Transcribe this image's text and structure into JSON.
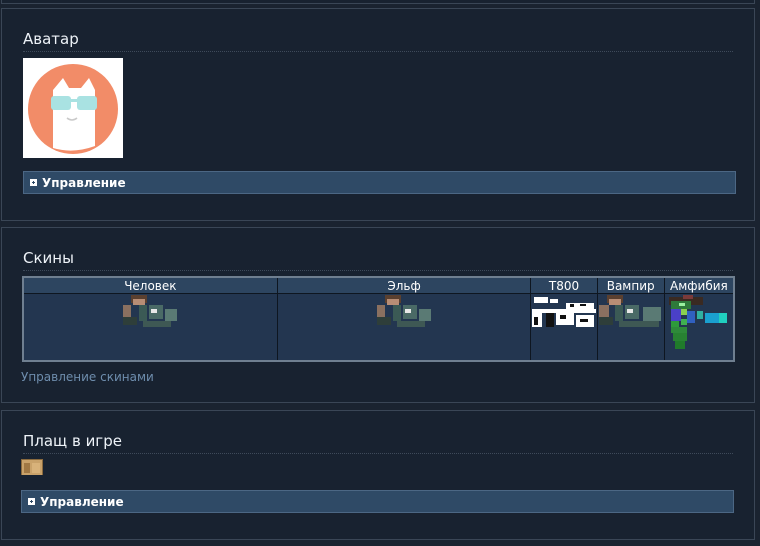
{
  "avatar_section": {
    "title": "Аватар",
    "manage_label": "Управление"
  },
  "skins_section": {
    "title": "Скины",
    "columns": [
      "Человек",
      "Эльф",
      "T800",
      "Вампир",
      "Амфибия"
    ],
    "manage_link": "Управление скинами"
  },
  "cape_section": {
    "title": "Плащ в игре",
    "manage_label": "Управление"
  },
  "colors": {
    "background": "#1a2330",
    "bar": "#2f4a66",
    "avatar_circle": "#f28c68",
    "link": "#6e8dad"
  }
}
